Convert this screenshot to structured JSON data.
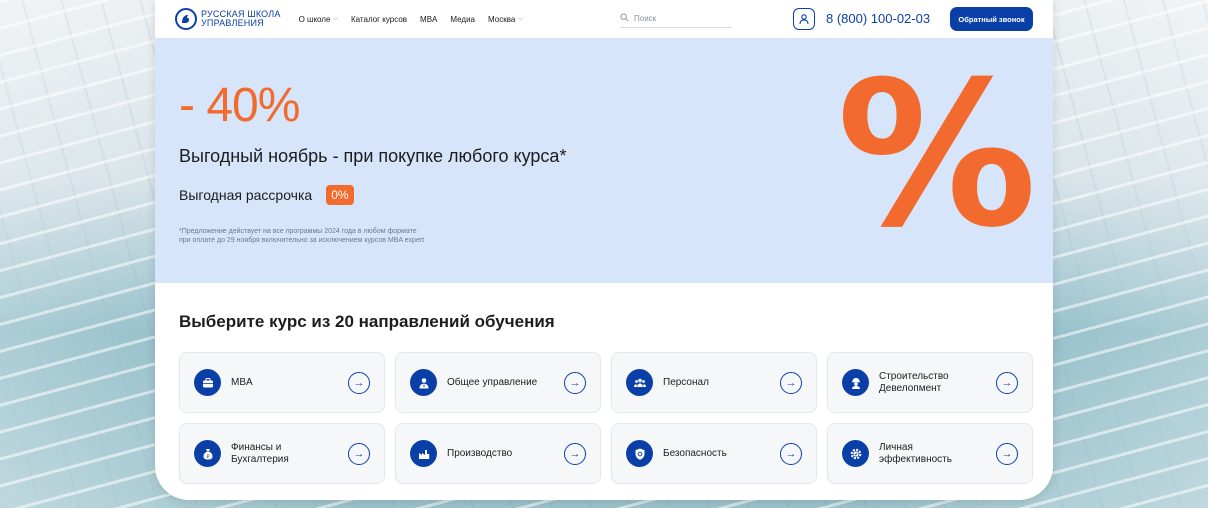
{
  "header": {
    "logo_line1": "РУССКАЯ ШКОЛА",
    "logo_line2": "УПРАВЛЕНИЯ",
    "nav": [
      {
        "label": "О школе",
        "has_dropdown": true
      },
      {
        "label": "Каталог курсов",
        "has_dropdown": false
      },
      {
        "label": "MBA",
        "has_dropdown": false
      },
      {
        "label": "Медиа",
        "has_dropdown": false
      },
      {
        "label": "Москва",
        "has_dropdown": true
      }
    ],
    "search_placeholder": "Поиск",
    "phone": "8 (800) 100-02-03",
    "callback_label": "Обратный звонок"
  },
  "hero": {
    "discount": "- 40%",
    "title": "Выгодный ноябрь - при покупке любого курса*",
    "installment": "Выгодная рассрочка",
    "installment_badge": "0%",
    "note_line1": "*Предложение действует на все программы 2024 года в любом формате",
    "note_line2": "при оплате до 29 ноября включительно за исключением курсов MBA expert",
    "big_symbol": "%",
    "accent_color": "#f26a2e",
    "background_color": "#d6e5f9"
  },
  "courses": {
    "title": "Выберите курс из 20 направлений обучения",
    "items": [
      {
        "label": "MBA",
        "icon": "briefcase-icon"
      },
      {
        "label": "Общее управление",
        "icon": "manager-icon"
      },
      {
        "label": "Персонал",
        "icon": "team-icon"
      },
      {
        "label": "Строительство\nДевелопмент",
        "icon": "builder-icon"
      },
      {
        "label": "Финансы и\nБухгалтерия",
        "icon": "money-bag-icon"
      },
      {
        "label": "Производство",
        "icon": "factory-icon"
      },
      {
        "label": "Безопасность",
        "icon": "shield-icon"
      },
      {
        "label": "Личная\nэффективность",
        "icon": "gear-check-icon"
      }
    ]
  },
  "brand_color": "#0b3fa8"
}
